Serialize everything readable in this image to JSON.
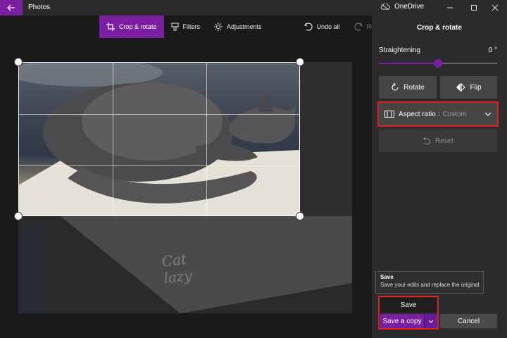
{
  "titlebar": {
    "app_name": "Photos",
    "onedrive_label": "OneDrive"
  },
  "toolbar": {
    "crop_rotate": "Crop & rotate",
    "filters": "Filters",
    "adjustments": "Adjustments",
    "undo_all": "Undo all",
    "redo_all": "Redo all"
  },
  "photo": {
    "handwritten_text": "Cat lazy"
  },
  "panel": {
    "title": "Crop & rotate",
    "straightening_label": "Straightening",
    "straightening_value": "0 °",
    "straightening_level": 0.5,
    "rotate_label": "Rotate",
    "flip_label": "Flip",
    "aspect_label": "Aspect ratio :",
    "aspect_value": "Custom",
    "reset_label": "Reset"
  },
  "tooltip": {
    "title": "Save",
    "description": "Save your edits and replace the original."
  },
  "actions": {
    "save": "Save",
    "save_copy": "Save a copy",
    "cancel": "Cancel"
  },
  "colors": {
    "accent": "#7b1fa2",
    "highlight": "#e02020",
    "panel_bg": "#2b2b2b"
  }
}
